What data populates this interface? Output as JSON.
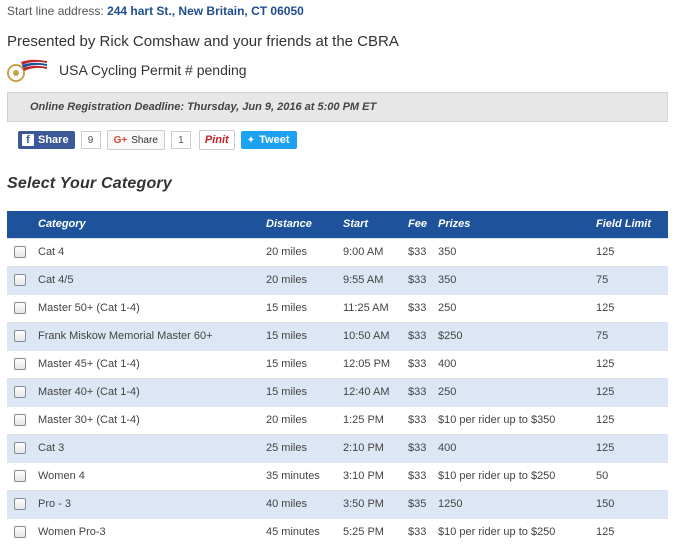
{
  "header": {
    "start_label": "Start line address: ",
    "start_address": "244 hart St., New Britain, CT  06050",
    "presented": "Presented by Rick Comshaw and your friends at the CBRA",
    "permit": "USA Cycling Permit # pending",
    "deadline": "Online Registration Deadline: Thursday, Jun 9, 2016 at 5:00 PM ET"
  },
  "social": {
    "facebook_label": "Share",
    "facebook_count": "9",
    "gplus_label": "Share",
    "gplus_count": "1",
    "pinterest_label": "Pinit",
    "twitter_label": "Tweet",
    "colors": {
      "facebook": "#3b5998",
      "twitter": "#1da1f2",
      "pinterest": "#cb2027"
    }
  },
  "section_title": "Select Your Category",
  "table": {
    "header_color": "#1e539b",
    "alt_row_color": "#dce6f4",
    "columns": [
      "Category",
      "Distance",
      "Start",
      "Fee",
      "Prizes",
      "Field Limit"
    ],
    "rows": [
      {
        "category": "Cat 4",
        "distance": "20 miles",
        "start": "9:00 AM",
        "fee": "$33",
        "prizes": "350",
        "limit": "125"
      },
      {
        "category": "Cat 4/5",
        "distance": "20 miles",
        "start": "9:55 AM",
        "fee": "$33",
        "prizes": "350",
        "limit": "75"
      },
      {
        "category": "Master 50+ (Cat 1-4)",
        "distance": "15 miles",
        "start": "11:25 AM",
        "fee": "$33",
        "prizes": "250",
        "limit": "125"
      },
      {
        "category": "Frank Miskow Memorial Master 60+",
        "distance": "15 miles",
        "start": "10:50 AM",
        "fee": "$33",
        "prizes": "$250",
        "limit": "75"
      },
      {
        "category": "Master 45+ (Cat 1-4)",
        "distance": "15 miles",
        "start": "12:05 PM",
        "fee": "$33",
        "prizes": "400",
        "limit": "125"
      },
      {
        "category": "Master 40+ (Cat 1-4)",
        "distance": "15 miles",
        "start": "12:40 AM",
        "fee": "$33",
        "prizes": "250",
        "limit": "125"
      },
      {
        "category": "Master 30+ (Cat 1-4)",
        "distance": "20 miles",
        "start": "1:25 PM",
        "fee": "$33",
        "prizes": "$10 per rider up to $350",
        "limit": "125"
      },
      {
        "category": "Cat 3",
        "distance": "25 miles",
        "start": "2:10 PM",
        "fee": "$33",
        "prizes": "400",
        "limit": "125"
      },
      {
        "category": "Women 4",
        "distance": "35 minutes",
        "start": "3:10 PM",
        "fee": "$33",
        "prizes": "$10 per rider up to $250",
        "limit": "50"
      },
      {
        "category": "Pro - 3",
        "distance": "40 miles",
        "start": "3:50 PM",
        "fee": "$35",
        "prizes": "1250",
        "limit": "150"
      },
      {
        "category": "Women Pro-3",
        "distance": "45 minutes",
        "start": "5:25 PM",
        "fee": "$33",
        "prizes": "$10 per rider up to $250",
        "limit": "125"
      }
    ]
  }
}
